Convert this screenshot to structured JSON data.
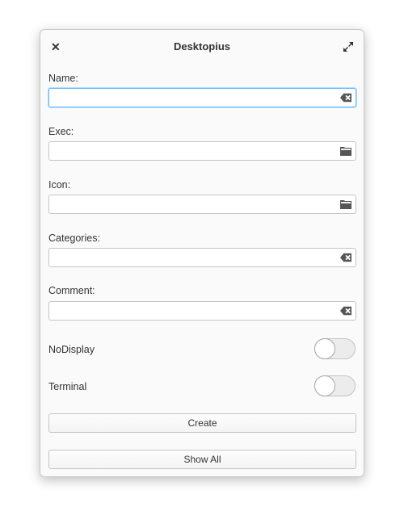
{
  "window": {
    "title": "Desktopius"
  },
  "fields": [
    {
      "label": "Name:",
      "value": "",
      "icon": "clear-icon"
    },
    {
      "label": "Exec:",
      "value": "",
      "icon": "folder-icon"
    },
    {
      "label": "Icon:",
      "value": "",
      "icon": "folder-icon"
    },
    {
      "label": "Categories:",
      "value": "",
      "icon": "clear-icon"
    },
    {
      "label": "Comment:",
      "value": "",
      "icon": "clear-icon"
    }
  ],
  "toggles": [
    {
      "label": "NoDisplay",
      "on": false
    },
    {
      "label": "Terminal",
      "on": false
    }
  ],
  "buttons": {
    "create": "Create",
    "show_all": "Show All"
  }
}
